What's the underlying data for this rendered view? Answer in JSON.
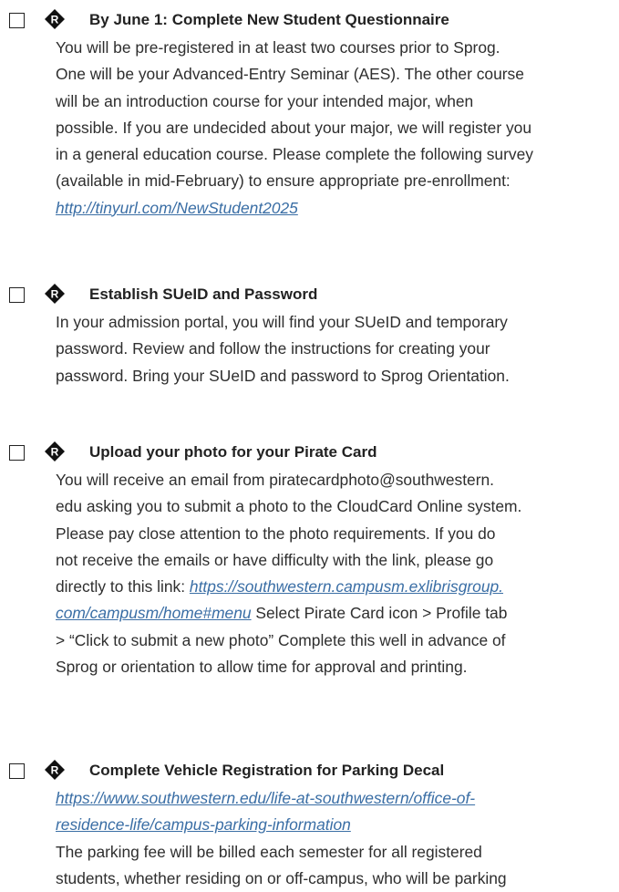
{
  "items": [
    {
      "title": "By June 1: Complete New Student Questionnaire",
      "lines": [
        [
          {
            "t": "You will be pre-registered in at least two courses prior to Sprog."
          }
        ],
        [
          {
            "t": "One will be your Advanced-Entry Seminar (AES). The other course"
          }
        ],
        [
          {
            "t": "will be an introduction course for your intended major, when"
          }
        ],
        [
          {
            "t": "possible. If you are undecided about your major, we will register you"
          }
        ],
        [
          {
            "t": "in a general education course. Please complete the following survey"
          }
        ],
        [
          {
            "t": "(available in mid-February) to ensure appropriate pre-enrollment:"
          }
        ],
        [
          {
            "t": "http://tinyurl.com/NewStudent2025",
            "link": true
          }
        ]
      ]
    },
    {
      "title": "Establish SUeID and Password",
      "lines": [
        [
          {
            "t": "In your admission portal, you will find your SUeID and temporary"
          }
        ],
        [
          {
            "t": "password. Review and follow the instructions for creating your"
          }
        ],
        [
          {
            "t": "password. Bring your SUeID and password to Sprog Orientation."
          }
        ]
      ]
    },
    {
      "title": "Upload your photo for your Pirate Card",
      "lines": [
        [
          {
            "t": "You will receive an email from piratecardphoto@southwestern."
          }
        ],
        [
          {
            "t": "edu asking you to submit a photo to the CloudCard Online system."
          }
        ],
        [
          {
            "t": "Please pay close attention to the photo requirements. If you do"
          }
        ],
        [
          {
            "t": "not receive the emails or have difficulty with the link, please go"
          }
        ],
        [
          {
            "t": "directly to this link: "
          },
          {
            "t": "https://southwestern.campusm.exlibrisgroup.",
            "link": true
          }
        ],
        [
          {
            "t": "com/campusm/home#menu",
            "link": true
          },
          {
            "t": " Select Pirate Card icon > Profile tab"
          }
        ],
        [
          {
            "t": "> “Click to submit a new photo” Complete this well in advance of"
          }
        ],
        [
          {
            "t": "Sprog or orientation to allow time for approval and printing."
          }
        ]
      ]
    },
    {
      "title": "Complete Vehicle Registration for Parking Decal",
      "lines": [
        [
          {
            "t": "https://www.southwestern.edu/life-at-southwestern/office-of-",
            "link": true
          }
        ],
        [
          {
            "t": "residence-life/campus-parking-information",
            "link": true
          }
        ],
        [
          {
            "t": "The parking fee will be billed each semester for all registered"
          }
        ],
        [
          {
            "t": "students, whether residing on or off-campus, who will be parking"
          }
        ]
      ]
    }
  ],
  "colors": {
    "text": "#2e2e2e",
    "link": "#3a6ea5",
    "mark": "#111111"
  },
  "icons": {
    "checkbox": "checkbox-icon",
    "marker": "r-diamond-icon"
  }
}
